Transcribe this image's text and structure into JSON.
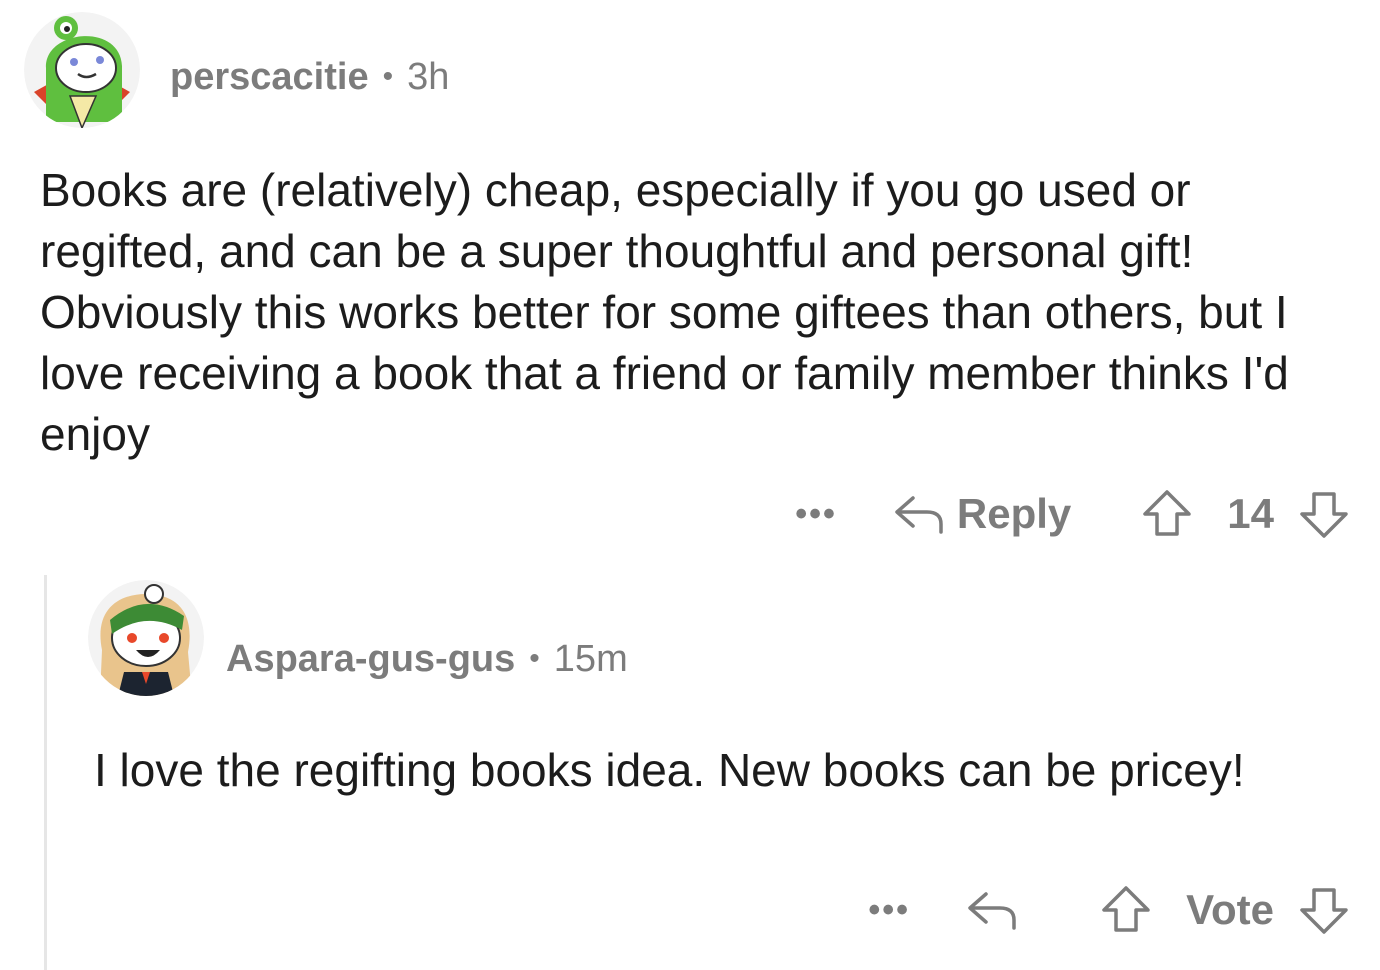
{
  "comments": [
    {
      "username": "perscacitie",
      "separator": "•",
      "time": "3h",
      "body": "Books are (relatively) cheap, especially if you go used or regifted, and can be a super thoughtful and personal gift! Obviously this works better for some giftees than others, but I love receiving a book that a friend or family member thinks I'd enjoy",
      "more_label": "•••",
      "reply_label": "Reply",
      "vote_label": "14",
      "avatar_icon": "snoo-frog-hood-avatar"
    },
    {
      "username": "Aspara-gus-gus",
      "separator": "•",
      "time": "15m",
      "body": "I love the regifting books idea.  New books can be pricey!",
      "more_label": "•••",
      "reply_label": "",
      "vote_label": "Vote",
      "avatar_icon": "snoo-headband-avatar"
    }
  ],
  "colors": {
    "meta_gray": "#7c7c7c",
    "text": "#1c1c1c",
    "thread_line": "#e6e6e6"
  }
}
